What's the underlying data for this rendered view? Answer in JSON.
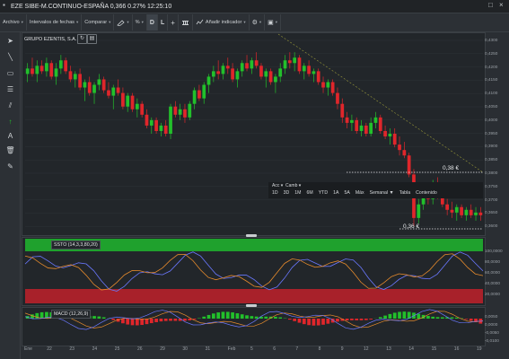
{
  "window": {
    "title": "EZE SIBE-M.CONTINUO-ESPAÑA 0,366 0.27% 12:25:10",
    "close_glyph": "×"
  },
  "toolbar": {
    "archivo": "Archivo",
    "intervalos": "Intervalos de fechas",
    "comparar": "Comparar",
    "percent": "%",
    "d": "D",
    "l": "L",
    "plus": "+",
    "indicador": "Añadir indicador",
    "dd": "▾"
  },
  "main_pane": {
    "title": "GRUPO EZENTIS, S.A.",
    "price_high_label": "0,38 €",
    "price_low_label": "0,36 €",
    "y_ticks": [
      "0,4300",
      "0,4250",
      "0,4200",
      "0,4150",
      "0,4100",
      "0,4050",
      "0,4000",
      "0,3950",
      "0,3900",
      "0,3850",
      "0,3800",
      "0,3750",
      "0,3700",
      "0,3650",
      "0,3600"
    ]
  },
  "time_range": {
    "acc": "Acc",
    "camb": "Camb",
    "buttons": [
      "1D",
      "3D",
      "1M",
      "6M",
      "YTD",
      "1A",
      "5A",
      "Máx",
      "Semanal ▼",
      "Tabla",
      "Contenido"
    ]
  },
  "ssto": {
    "label": "SSTO (14,3,3,80,20)",
    "ticks": [
      "100,0000",
      "80,0000",
      "60,0000",
      "40,0000",
      "20,0000"
    ]
  },
  "macd": {
    "label": "MACD (12,26,9)",
    "ticks": [
      "0,0050",
      "0,0000",
      "-0,0050",
      "-0,0100"
    ]
  },
  "x_axis": [
    "Ene",
    "22",
    "23",
    "24",
    "25",
    "26",
    "29",
    "30",
    "31",
    "Feb",
    "5",
    "6",
    "7",
    "8",
    "9",
    "12",
    "13",
    "14",
    "15",
    "16",
    "19"
  ],
  "colors": {
    "up": "#22c02b",
    "down": "#e0262b",
    "ssto_k": "#6a78ff",
    "ssto_d": "#e58a2c",
    "overbought": "#1fa12d",
    "oversold": "#a8212a"
  },
  "chart_data": {
    "type": "candlestick",
    "candles": [
      {
        "o": 0.418,
        "h": 0.422,
        "l": 0.415,
        "c": 0.42
      },
      {
        "o": 0.42,
        "h": 0.424,
        "l": 0.417,
        "c": 0.418
      },
      {
        "o": 0.418,
        "h": 0.423,
        "l": 0.415,
        "c": 0.421
      },
      {
        "o": 0.421,
        "h": 0.423,
        "l": 0.418,
        "c": 0.419
      },
      {
        "o": 0.419,
        "h": 0.424,
        "l": 0.417,
        "c": 0.422
      },
      {
        "o": 0.422,
        "h": 0.423,
        "l": 0.416,
        "c": 0.417
      },
      {
        "o": 0.417,
        "h": 0.422,
        "l": 0.414,
        "c": 0.42
      },
      {
        "o": 0.42,
        "h": 0.425,
        "l": 0.418,
        "c": 0.423
      },
      {
        "o": 0.423,
        "h": 0.424,
        "l": 0.418,
        "c": 0.419
      },
      {
        "o": 0.419,
        "h": 0.421,
        "l": 0.415,
        "c": 0.416
      },
      {
        "o": 0.416,
        "h": 0.419,
        "l": 0.413,
        "c": 0.418
      },
      {
        "o": 0.418,
        "h": 0.42,
        "l": 0.412,
        "c": 0.413
      },
      {
        "o": 0.413,
        "h": 0.416,
        "l": 0.408,
        "c": 0.415
      },
      {
        "o": 0.415,
        "h": 0.417,
        "l": 0.41,
        "c": 0.411
      },
      {
        "o": 0.411,
        "h": 0.415,
        "l": 0.407,
        "c": 0.414
      },
      {
        "o": 0.414,
        "h": 0.418,
        "l": 0.412,
        "c": 0.416
      },
      {
        "o": 0.416,
        "h": 0.417,
        "l": 0.411,
        "c": 0.412
      },
      {
        "o": 0.412,
        "h": 0.415,
        "l": 0.409,
        "c": 0.41
      },
      {
        "o": 0.41,
        "h": 0.414,
        "l": 0.405,
        "c": 0.413
      },
      {
        "o": 0.413,
        "h": 0.416,
        "l": 0.41,
        "c": 0.411
      },
      {
        "o": 0.411,
        "h": 0.413,
        "l": 0.405,
        "c": 0.406
      },
      {
        "o": 0.406,
        "h": 0.411,
        "l": 0.404,
        "c": 0.41
      },
      {
        "o": 0.41,
        "h": 0.411,
        "l": 0.404,
        "c": 0.405
      },
      {
        "o": 0.405,
        "h": 0.409,
        "l": 0.402,
        "c": 0.407
      },
      {
        "o": 0.407,
        "h": 0.408,
        "l": 0.402,
        "c": 0.403
      },
      {
        "o": 0.403,
        "h": 0.405,
        "l": 0.398,
        "c": 0.399
      },
      {
        "o": 0.399,
        "h": 0.402,
        "l": 0.396,
        "c": 0.401
      },
      {
        "o": 0.401,
        "h": 0.402,
        "l": 0.396,
        "c": 0.397
      },
      {
        "o": 0.397,
        "h": 0.4,
        "l": 0.395,
        "c": 0.399
      },
      {
        "o": 0.399,
        "h": 0.401,
        "l": 0.395,
        "c": 0.396
      },
      {
        "o": 0.396,
        "h": 0.407,
        "l": 0.394,
        "c": 0.406
      },
      {
        "o": 0.406,
        "h": 0.408,
        "l": 0.402,
        "c": 0.403
      },
      {
        "o": 0.403,
        "h": 0.407,
        "l": 0.401,
        "c": 0.405
      },
      {
        "o": 0.405,
        "h": 0.407,
        "l": 0.4,
        "c": 0.402
      },
      {
        "o": 0.402,
        "h": 0.408,
        "l": 0.401,
        "c": 0.407
      },
      {
        "o": 0.407,
        "h": 0.413,
        "l": 0.405,
        "c": 0.412
      },
      {
        "o": 0.412,
        "h": 0.414,
        "l": 0.408,
        "c": 0.409
      },
      {
        "o": 0.409,
        "h": 0.415,
        "l": 0.407,
        "c": 0.414
      },
      {
        "o": 0.414,
        "h": 0.418,
        "l": 0.411,
        "c": 0.417
      },
      {
        "o": 0.417,
        "h": 0.421,
        "l": 0.415,
        "c": 0.419
      },
      {
        "o": 0.419,
        "h": 0.423,
        "l": 0.416,
        "c": 0.418
      },
      {
        "o": 0.418,
        "h": 0.422,
        "l": 0.416,
        "c": 0.421
      },
      {
        "o": 0.421,
        "h": 0.424,
        "l": 0.418,
        "c": 0.42
      },
      {
        "o": 0.42,
        "h": 0.422,
        "l": 0.415,
        "c": 0.416
      },
      {
        "o": 0.416,
        "h": 0.42,
        "l": 0.413,
        "c": 0.419
      },
      {
        "o": 0.419,
        "h": 0.423,
        "l": 0.417,
        "c": 0.422
      },
      {
        "o": 0.422,
        "h": 0.425,
        "l": 0.419,
        "c": 0.42
      },
      {
        "o": 0.42,
        "h": 0.424,
        "l": 0.418,
        "c": 0.423
      },
      {
        "o": 0.423,
        "h": 0.426,
        "l": 0.42,
        "c": 0.421
      },
      {
        "o": 0.421,
        "h": 0.422,
        "l": 0.416,
        "c": 0.417
      },
      {
        "o": 0.417,
        "h": 0.42,
        "l": 0.413,
        "c": 0.419
      },
      {
        "o": 0.419,
        "h": 0.42,
        "l": 0.414,
        "c": 0.415
      },
      {
        "o": 0.415,
        "h": 0.418,
        "l": 0.411,
        "c": 0.417
      },
      {
        "o": 0.417,
        "h": 0.422,
        "l": 0.415,
        "c": 0.42
      },
      {
        "o": 0.42,
        "h": 0.425,
        "l": 0.418,
        "c": 0.423
      },
      {
        "o": 0.423,
        "h": 0.426,
        "l": 0.42,
        "c": 0.422
      },
      {
        "o": 0.422,
        "h": 0.426,
        "l": 0.419,
        "c": 0.424
      },
      {
        "o": 0.424,
        "h": 0.425,
        "l": 0.418,
        "c": 0.419
      },
      {
        "o": 0.419,
        "h": 0.422,
        "l": 0.416,
        "c": 0.421
      },
      {
        "o": 0.421,
        "h": 0.423,
        "l": 0.417,
        "c": 0.418
      },
      {
        "o": 0.418,
        "h": 0.42,
        "l": 0.415,
        "c": 0.419
      },
      {
        "o": 0.419,
        "h": 0.42,
        "l": 0.414,
        "c": 0.415
      },
      {
        "o": 0.415,
        "h": 0.417,
        "l": 0.411,
        "c": 0.413
      },
      {
        "o": 0.413,
        "h": 0.416,
        "l": 0.41,
        "c": 0.415
      },
      {
        "o": 0.415,
        "h": 0.416,
        "l": 0.41,
        "c": 0.411
      },
      {
        "o": 0.411,
        "h": 0.413,
        "l": 0.405,
        "c": 0.407
      },
      {
        "o": 0.407,
        "h": 0.409,
        "l": 0.4,
        "c": 0.402
      },
      {
        "o": 0.402,
        "h": 0.404,
        "l": 0.398,
        "c": 0.4
      },
      {
        "o": 0.4,
        "h": 0.403,
        "l": 0.397,
        "c": 0.401
      },
      {
        "o": 0.401,
        "h": 0.402,
        "l": 0.396,
        "c": 0.397
      },
      {
        "o": 0.397,
        "h": 0.401,
        "l": 0.395,
        "c": 0.399
      },
      {
        "o": 0.399,
        "h": 0.4,
        "l": 0.395,
        "c": 0.396
      },
      {
        "o": 0.396,
        "h": 0.402,
        "l": 0.395,
        "c": 0.4
      },
      {
        "o": 0.4,
        "h": 0.404,
        "l": 0.398,
        "c": 0.402
      },
      {
        "o": 0.402,
        "h": 0.403,
        "l": 0.396,
        "c": 0.397
      },
      {
        "o": 0.397,
        "h": 0.399,
        "l": 0.394,
        "c": 0.395
      },
      {
        "o": 0.395,
        "h": 0.398,
        "l": 0.392,
        "c": 0.396
      },
      {
        "o": 0.396,
        "h": 0.398,
        "l": 0.391,
        "c": 0.392
      },
      {
        "o": 0.392,
        "h": 0.395,
        "l": 0.388,
        "c": 0.39
      },
      {
        "o": 0.39,
        "h": 0.393,
        "l": 0.387,
        "c": 0.388
      },
      {
        "o": 0.388,
        "h": 0.389,
        "l": 0.38,
        "c": 0.381
      },
      {
        "o": 0.381,
        "h": 0.383,
        "l": 0.362,
        "c": 0.365
      },
      {
        "o": 0.365,
        "h": 0.372,
        "l": 0.363,
        "c": 0.37
      },
      {
        "o": 0.37,
        "h": 0.376,
        "l": 0.368,
        "c": 0.374
      },
      {
        "o": 0.374,
        "h": 0.378,
        "l": 0.37,
        "c": 0.372
      },
      {
        "o": 0.372,
        "h": 0.379,
        "l": 0.37,
        "c": 0.377
      },
      {
        "o": 0.377,
        "h": 0.38,
        "l": 0.372,
        "c": 0.373
      },
      {
        "o": 0.373,
        "h": 0.375,
        "l": 0.369,
        "c": 0.37
      },
      {
        "o": 0.37,
        "h": 0.372,
        "l": 0.366,
        "c": 0.368
      },
      {
        "o": 0.368,
        "h": 0.371,
        "l": 0.365,
        "c": 0.367
      },
      {
        "o": 0.367,
        "h": 0.37,
        "l": 0.364,
        "c": 0.369
      },
      {
        "o": 0.369,
        "h": 0.37,
        "l": 0.365,
        "c": 0.366
      },
      {
        "o": 0.366,
        "h": 0.369,
        "l": 0.364,
        "c": 0.368
      },
      {
        "o": 0.368,
        "h": 0.37,
        "l": 0.365,
        "c": 0.366
      },
      {
        "o": 0.366,
        "h": 0.369,
        "l": 0.364,
        "c": 0.367
      },
      {
        "o": 0.367,
        "h": 0.369,
        "l": 0.364,
        "c": 0.366
      }
    ],
    "y_range": [
      0.36,
      0.432
    ],
    "reference_levels": [
      0.38,
      0.36
    ]
  }
}
